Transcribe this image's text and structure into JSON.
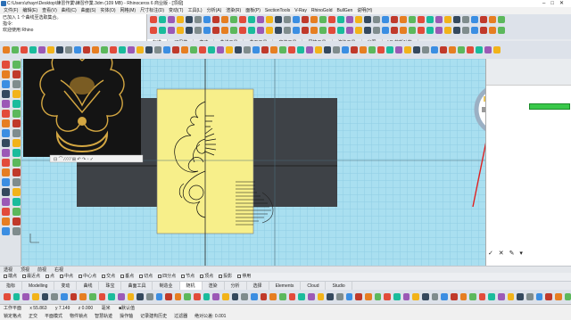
{
  "window": {
    "title": "C:\\Users\\zhayn\\Desktop\\練習作業\\練習作業.3dm (109 MB) - Rhinoceros 6 商业版 - [顶视]"
  },
  "menu": [
    "文件(F)",
    "编辑(E)",
    "查看(V)",
    "曲线(C)",
    "曲面(S)",
    "实体(O)",
    "网格(M)",
    "尺寸标注(D)",
    "变动(T)",
    "工具(L)",
    "分析(A)",
    "渲染(R)",
    "面板(P)",
    "SectionTools",
    "V-Ray",
    "RhinoGold",
    "BullGen",
    "说明(H)"
  ],
  "command": {
    "lines": [
      "已加入 1 个曲线至选取集合。",
      "指令:",
      "欢迎使用 Rhino"
    ]
  },
  "toolbar_tabs": [
    "可见性",
    "变动",
    "曲线工具",
    "曲面工具",
    "实体工具",
    "网格工具",
    "渲染工具",
    "出图",
    "V6 的新功能"
  ],
  "left_tab": "标准",
  "viewport": {
    "label": "顶视",
    "gumball_menu_hint": "右键菜单"
  },
  "bottom_view_tabs": [
    "透视",
    "顶视",
    "前视",
    "右视"
  ],
  "snaps": [
    "端点",
    "最近点",
    "点",
    "中点",
    "中心点",
    "交点",
    "垂点",
    "切点",
    "四分点",
    "节点",
    "顶点",
    "投影",
    "停用"
  ],
  "mode_tabs": [
    {
      "label": "指标",
      "active": false
    },
    {
      "label": "Modelling",
      "active": false
    },
    {
      "label": "变动",
      "active": false
    },
    {
      "label": "曲线",
      "active": false
    },
    {
      "label": "珠宝",
      "active": false
    },
    {
      "label": "曲面工具",
      "active": false
    },
    {
      "label": "制造业",
      "active": false
    },
    {
      "label": "随机",
      "active": true
    },
    {
      "label": "渲染",
      "active": false
    },
    {
      "label": "分析",
      "active": false
    },
    {
      "label": "选择",
      "active": false
    },
    {
      "label": "Elements",
      "active": false
    },
    {
      "label": "Cloud",
      "active": false
    },
    {
      "label": "Studio",
      "active": false
    }
  ],
  "status": {
    "cplane": "工作平面",
    "x": "x 55.863",
    "y": "y 7.149",
    "z": "z 0.000",
    "unit": "毫米",
    "layer": "■默认值",
    "flags": [
      "锁定格点",
      "正交",
      "平面模式",
      "物件锁点",
      "智慧轨迹",
      "操作轴",
      "记录建构历史",
      "过滤器",
      "绝对公差: 0.001"
    ]
  },
  "colors": {
    "accent_red": "#e02020",
    "viewport_bg": "#a9dff0",
    "paper_yellow": "#f7ef8a",
    "dark_plane": "#3e4247"
  }
}
